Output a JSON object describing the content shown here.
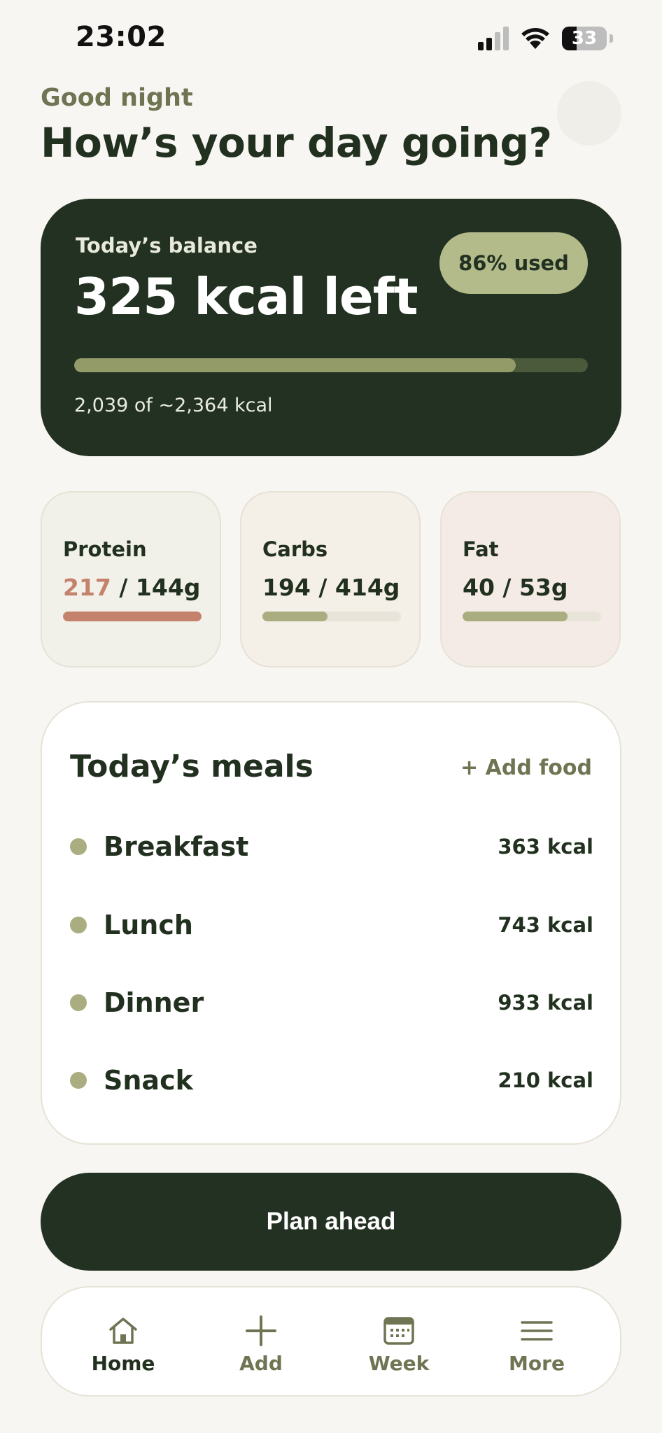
{
  "status": {
    "time": "23:02",
    "battery": "33"
  },
  "header": {
    "greeting": "Good night",
    "headline": "How’s your day going?"
  },
  "balance": {
    "label": "Today’s balance",
    "value": "325 kcal left",
    "used_pill": "86% used",
    "used_fraction": 0.86,
    "subtext": "2,039 of ~2,364 kcal"
  },
  "macros": [
    {
      "title": "Protein",
      "current": "217",
      "target": " / 144g",
      "fraction": 1.0,
      "over": true
    },
    {
      "title": "Carbs",
      "value": "194 / 414g",
      "fraction": 0.47,
      "over": false
    },
    {
      "title": "Fat",
      "value": "40 / 53g",
      "fraction": 0.76,
      "over": false
    }
  ],
  "meals": {
    "title": "Today’s meals",
    "add_label": "+ Add food",
    "items": [
      {
        "name": "Breakfast",
        "kcal": "363 kcal"
      },
      {
        "name": "Lunch",
        "kcal": "743 kcal"
      },
      {
        "name": "Dinner",
        "kcal": "933 kcal"
      },
      {
        "name": "Snack",
        "kcal": "210 kcal"
      }
    ]
  },
  "plan_button": "Plan ahead",
  "nav": [
    {
      "label": "Home",
      "icon": "home-icon",
      "active": true
    },
    {
      "label": "Add",
      "icon": "plus-icon",
      "active": false
    },
    {
      "label": "Week",
      "icon": "calendar-icon",
      "active": false
    },
    {
      "label": "More",
      "icon": "menu-icon",
      "active": false
    }
  ],
  "colors": {
    "dark_green": "#223121",
    "olive": "#6f7553",
    "sage": "#a9ad80",
    "pill": "#b3bb8b",
    "terracotta": "#c4826d",
    "background": "#f8f6f2"
  }
}
